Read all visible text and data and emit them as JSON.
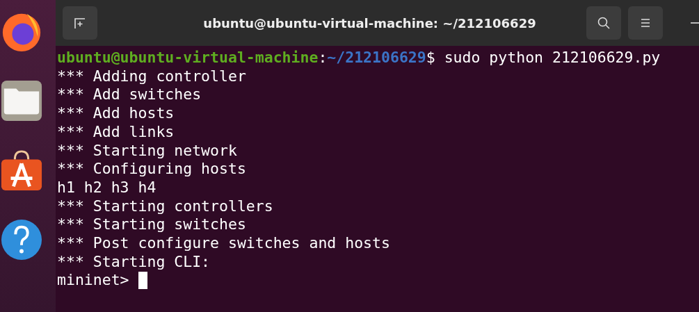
{
  "window": {
    "title": "ubuntu@ubuntu-virtual-machine: ~/212106629"
  },
  "terminal": {
    "prompt": {
      "user_host": "ubuntu@ubuntu-virtual-machine",
      "separator": ":",
      "path": "~/212106629",
      "symbol": "$",
      "command": " sudo python 212106629.py"
    },
    "output_lines": [
      "*** Adding controller",
      "*** Add switches",
      "*** Add hosts",
      "*** Add links",
      "*** Starting network",
      "*** Configuring hosts",
      "h1 h2 h3 h4",
      "*** Starting controllers",
      "*** Starting switches",
      "*** Post configure switches and hosts",
      "*** Starting CLI:"
    ],
    "input_prompt": "mininet> "
  }
}
